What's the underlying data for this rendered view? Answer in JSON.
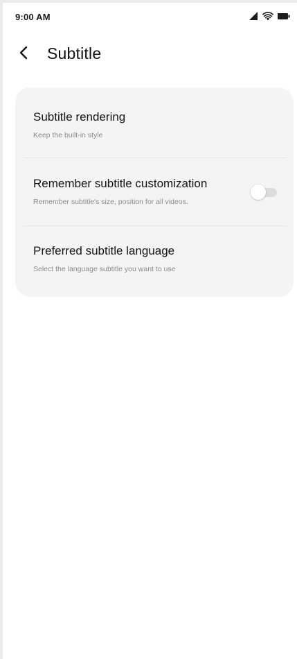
{
  "status_bar": {
    "time": "9:00 AM",
    "icons": [
      "signal-icon",
      "wifi-icon",
      "battery-icon"
    ]
  },
  "header": {
    "back_icon": "chevron-left-icon",
    "title": "Subtitle"
  },
  "settings": {
    "items": [
      {
        "title": "Subtitle rendering",
        "subtitle": "Keep the built-in style"
      },
      {
        "title": "Remember subtitle customization",
        "subtitle": "Remember subtitle's size, position for all videos.",
        "toggle": false
      },
      {
        "title": "Preferred subtitle language",
        "subtitle": "Select the language subtitle you want to use"
      }
    ]
  },
  "colors": {
    "background": "#ffffff",
    "card": "#f4f4f4",
    "title_text": "#141414",
    "subtitle_text": "#8a8a8a",
    "toggle_off_track": "#dcdcdc"
  }
}
